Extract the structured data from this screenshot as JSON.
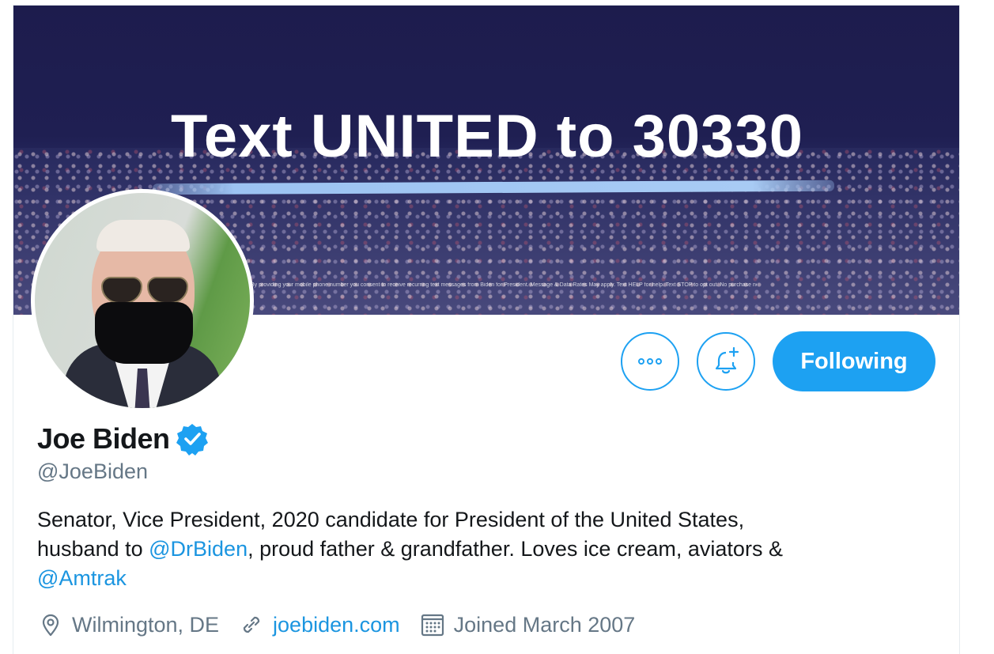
{
  "banner": {
    "headline": "Text UNITED to 30330",
    "fineprint": "By providing your mobile phone number you consent to receive recurring text messages from Biden for President. Message & Data Rates May apply. Text HELP for help. Text STOP to opt out. No purchase necessary."
  },
  "profile": {
    "display_name": "Joe Biden",
    "handle": "@JoeBiden",
    "verified": true
  },
  "actions": {
    "more_icon": "more-icon",
    "notify_icon": "bell-add-icon",
    "following_label": "Following"
  },
  "bio": {
    "line1": "Senator, Vice President, 2020 candidate for President of the United States,",
    "line2_prefix": "husband to ",
    "mention1": "@DrBiden",
    "line2_suffix": ", proud father & grandfather. Loves ice cream, aviators &",
    "mention2": "@Amtrak"
  },
  "meta": {
    "location": "Wilmington, DE",
    "website": "joebiden.com",
    "joined": "Joined March 2007"
  },
  "colors": {
    "accent": "#1da1f2",
    "link": "#1b95e0",
    "secondary_text": "#657786",
    "primary_text": "#14171a",
    "banner_bg": "#1d1c4d"
  }
}
